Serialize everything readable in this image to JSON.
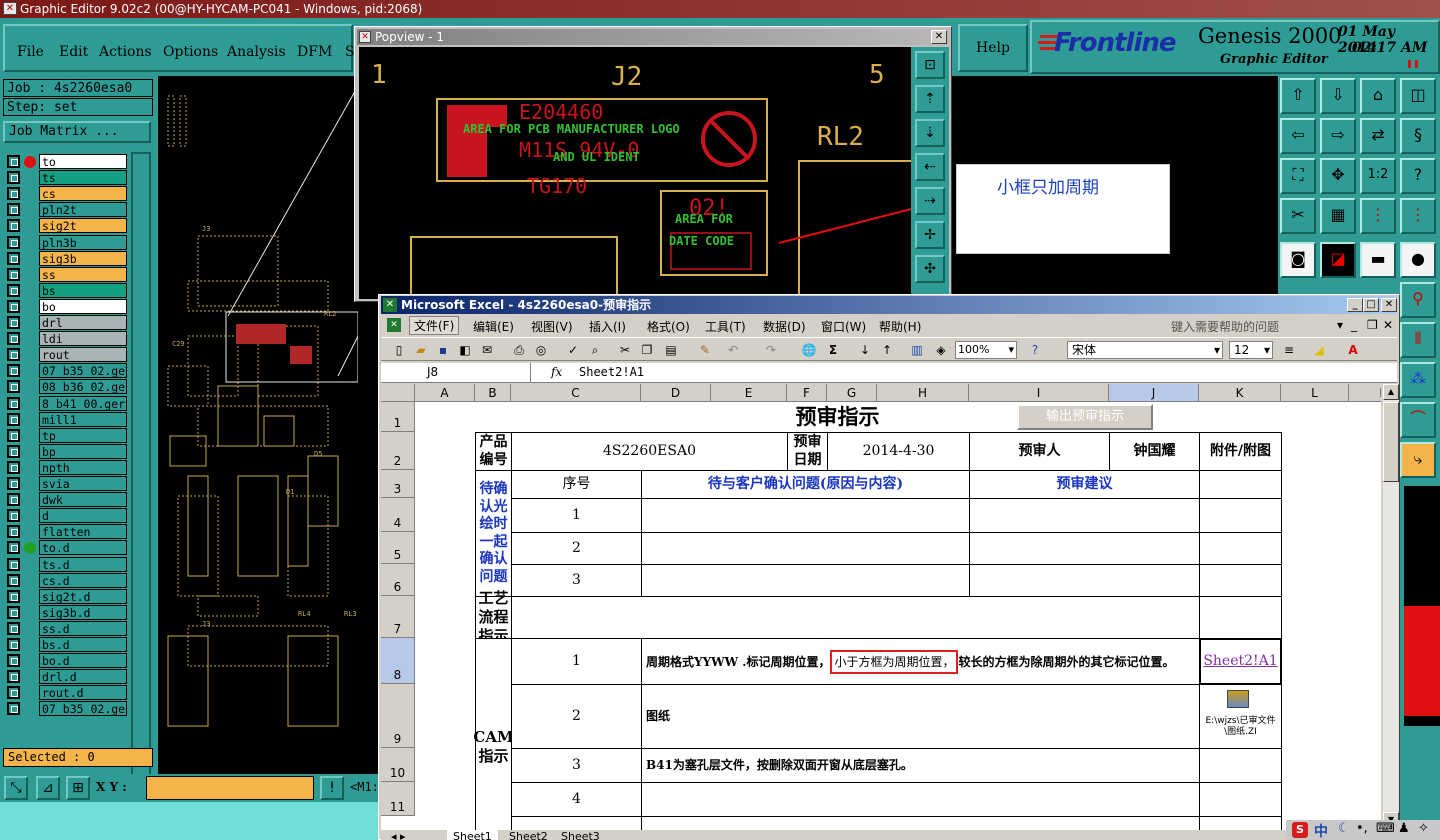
{
  "genesis": {
    "title": "Graphic Editor 9.02c2 (00@HY-HYCAM-PC041 - Windows, pid:2068)",
    "menu": [
      "File",
      "Edit",
      "Actions",
      "Options",
      "Analysis",
      "DFM",
      "S"
    ],
    "help": "Help",
    "brand": "Frontline",
    "product": "Genesis 2000",
    "subtitle": "Graphic Editor",
    "date": "01 May 2014",
    "time": "02:17 AM",
    "job_label": "Job : 4s2260esa0",
    "step_label": "Step: set",
    "job_matrix": "Job Matrix ...",
    "selected": "Selected : 0",
    "xy_label": "X Y :",
    "xy_value": "",
    "layers": [
      {
        "name": "to",
        "color": "#ffffff",
        "dot": "#e01010"
      },
      {
        "name": "ts",
        "color": "#16a083"
      },
      {
        "name": "cs",
        "color": "#f4b44a"
      },
      {
        "name": "pln2t",
        "color": "#2e9c95"
      },
      {
        "name": "sig2t",
        "color": "#f4b44a"
      },
      {
        "name": "pln3b",
        "color": "#2e9c95"
      },
      {
        "name": "sig3b",
        "color": "#f4b44a"
      },
      {
        "name": "ss",
        "color": "#f4b44a"
      },
      {
        "name": "bs",
        "color": "#16a083"
      },
      {
        "name": "bo",
        "color": "#ffffff"
      },
      {
        "name": "drl",
        "color": "#a8b4b4"
      },
      {
        "name": "ldi",
        "color": "#a8b4b4"
      },
      {
        "name": "rout",
        "color": "#a8b4b4"
      },
      {
        "name": "07_b35_02.ge",
        "color": "#2e9c95"
      },
      {
        "name": "08_b36_02.ge",
        "color": "#2e9c95"
      },
      {
        "name": "8_b41_00.ger",
        "color": "#2e9c95"
      },
      {
        "name": "mill1",
        "color": "#2e9c95"
      },
      {
        "name": "tp",
        "color": "#2e9c95"
      },
      {
        "name": "bp",
        "color": "#2e9c95"
      },
      {
        "name": "npth",
        "color": "#2e9c95"
      },
      {
        "name": "svia",
        "color": "#2e9c95"
      },
      {
        "name": "dwk",
        "color": "#2e9c95"
      },
      {
        "name": "d",
        "color": "#2e9c95"
      },
      {
        "name": "flatten",
        "color": "#2e9c95"
      },
      {
        "name": "to.d",
        "color": "#2e9c95",
        "dot": "#20a020"
      },
      {
        "name": "ts.d",
        "color": "#2e9c95"
      },
      {
        "name": "cs.d",
        "color": "#2e9c95"
      },
      {
        "name": "sig2t.d",
        "color": "#2e9c95"
      },
      {
        "name": "sig3b.d",
        "color": "#2e9c95"
      },
      {
        "name": "ss.d",
        "color": "#2e9c95"
      },
      {
        "name": "bs.d",
        "color": "#2e9c95"
      },
      {
        "name": "bo.d",
        "color": "#2e9c95"
      },
      {
        "name": "drl.d",
        "color": "#2e9c95"
      },
      {
        "name": "rout.d",
        "color": "#2e9c95"
      },
      {
        "name": "07_b35_02.ge",
        "color": "#2e9c95"
      }
    ],
    "bottom_right": "<M1:"
  },
  "popview": {
    "title": "Popview - 1",
    "pin1": "1",
    "j2": "J2",
    "pin5": "5",
    "rl2": "RL2",
    "logo_lines": [
      "E204460",
      "AREA FOR PCB MANUFACTURER LOGO",
      "M11S 94V-0",
      "AND UL IDENT",
      "TG170"
    ],
    "date_code_top": "02!",
    "date_code_lines": [
      "AREA FOR",
      "DATE CODE"
    ]
  },
  "callout": {
    "text": "小框只加周期"
  },
  "excel": {
    "title": "Microsoft Excel - 4s2260esa0-预审指示",
    "menu": [
      "文件(F)",
      "编辑(E)",
      "视图(V)",
      "插入(I)",
      "格式(O)",
      "工具(T)",
      "数据(D)",
      "窗口(W)",
      "帮助(H)"
    ],
    "help_placeholder": "键入需要帮助的问题",
    "zoom": "100%",
    "font": "宋体",
    "font_size": "12",
    "name_box": "J8",
    "formula": "Sheet2!A1",
    "columns": [
      "A",
      "B",
      "C",
      "D",
      "E",
      "F",
      "G",
      "H",
      "I",
      "J",
      "K",
      "L",
      "M"
    ],
    "rows": [
      "1",
      "2",
      "3",
      "4",
      "5",
      "6",
      "7",
      "8",
      "9",
      "10",
      "11"
    ],
    "floating_button": "输出预审指示",
    "sheet_title": "预审指示",
    "r2": {
      "a": "产品编号",
      "b": "4S2260ESA0",
      "e": "预审日期",
      "f": "2014-4-30",
      "h": "预审人",
      "i": "钟国耀",
      "j": "附件/附图"
    },
    "r3": {
      "b": "序号",
      "c": "待与客户确认问题(原因与内容)",
      "h": "预审建议"
    },
    "confirm_label": "待确认光绘时一起确认问题",
    "seq": [
      "1",
      "2",
      "3"
    ],
    "r7": "工艺流程指示",
    "cam_label": "CAM指示",
    "cam_rows": [
      {
        "n": "1",
        "pre": "周期格式YYWW .标记周期位置，",
        "box": "小于方框为周期位置，",
        "post": "较长的方框为除周期外的其它标记位置。",
        "link": "Sheet2!A1"
      },
      {
        "n": "2",
        "text": "图纸",
        "attach": "E:\\wjzs\\已审文件\\图纸.ZI"
      },
      {
        "n": "3",
        "text": "B41为塞孔层文件，按删除双面开窗从底层塞孔。"
      },
      {
        "n": "4",
        "text": ""
      }
    ],
    "sheets": [
      "Sheet1",
      "Sheet2",
      "Sheet3"
    ]
  },
  "tray": {
    "ime": "中"
  }
}
